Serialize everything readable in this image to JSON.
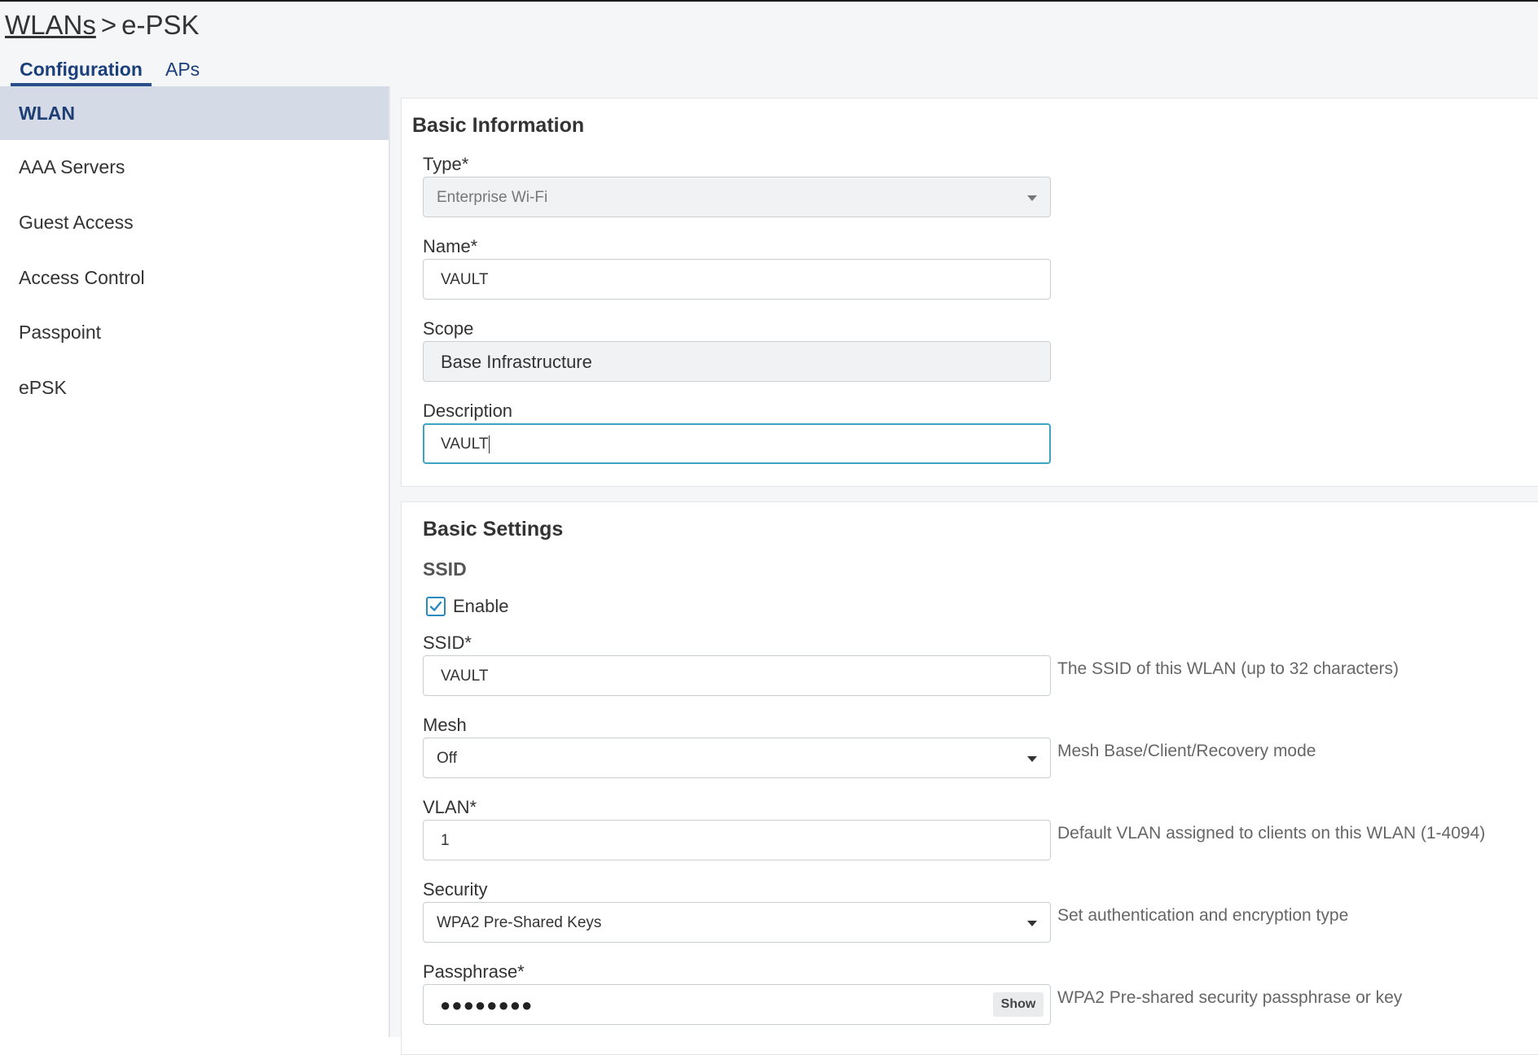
{
  "breadcrumb": {
    "parent": "WLANs",
    "separator": ">",
    "current": "e-PSK"
  },
  "tabs": [
    {
      "label": "Configuration",
      "active": true
    },
    {
      "label": "APs",
      "active": false
    }
  ],
  "sidebar": {
    "items": [
      {
        "label": "WLAN",
        "active": true
      },
      {
        "label": "AAA Servers"
      },
      {
        "label": "Guest Access"
      },
      {
        "label": "Access Control"
      },
      {
        "label": "Passpoint"
      },
      {
        "label": "ePSK"
      }
    ]
  },
  "basic_information": {
    "title": "Basic Information",
    "type": {
      "label": "Type*",
      "value": "Enterprise Wi-Fi"
    },
    "name": {
      "label": "Name*",
      "value": "VAULT"
    },
    "scope": {
      "label": "Scope",
      "value": "Base Infrastructure"
    },
    "description": {
      "label": "Description",
      "value": "VAULT"
    }
  },
  "basic_settings": {
    "title": "Basic Settings",
    "ssid_section": "SSID",
    "enable": {
      "label": "Enable",
      "checked": true
    },
    "ssid": {
      "label": "SSID*",
      "value": "VAULT",
      "hint": "The SSID of this WLAN (up to 32 characters)"
    },
    "mesh": {
      "label": "Mesh",
      "value": "Off",
      "hint": "Mesh Base/Client/Recovery mode"
    },
    "vlan": {
      "label": "VLAN*",
      "value": "1",
      "hint": "Default VLAN assigned to clients on this WLAN (1-4094)"
    },
    "security": {
      "label": "Security",
      "value": "WPA2 Pre-Shared Keys",
      "hint": "Set authentication and encryption type"
    },
    "passphrase": {
      "label": "Passphrase*",
      "masked": "●●●●●●●●",
      "show_label": "Show",
      "hint": "WPA2 Pre-shared security passphrase or key"
    }
  },
  "colors": {
    "accent": "#2a4e8a",
    "focus": "#3aa6c4",
    "active_nav_bg": "#d5dbe6",
    "checkbox": "#2a8ac0"
  }
}
